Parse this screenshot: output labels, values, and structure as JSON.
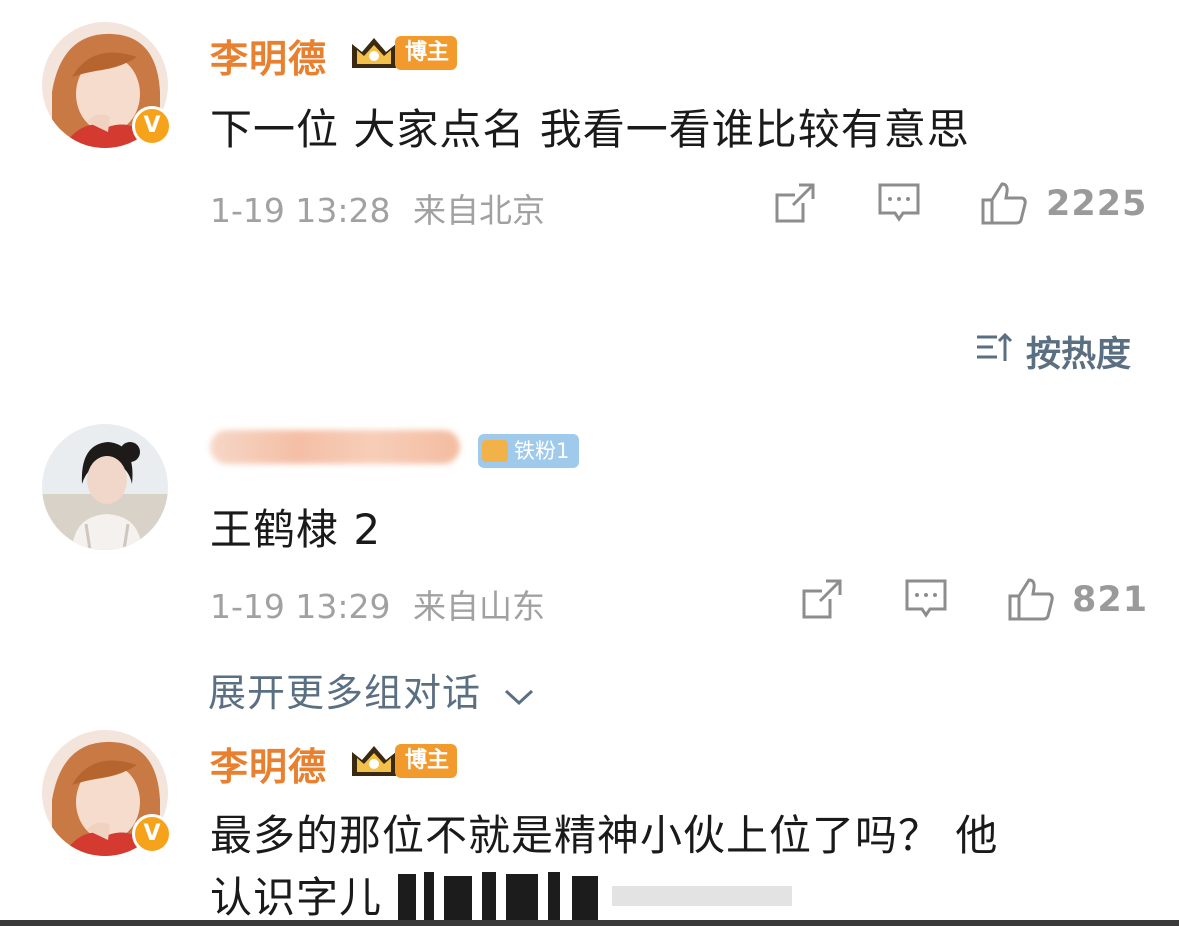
{
  "comments": [
    {
      "username": "李明德",
      "badge": "博主",
      "text": "下一位 大家点名 我看一看谁比较有意思",
      "time": "1-19 13:28",
      "location": "来自北京",
      "likes": "2225",
      "verified_mark": "V"
    },
    {
      "username": "",
      "badge": "铁粉1",
      "text": "王鹤棣 2",
      "time": "1-19 13:29",
      "location": "来自山东",
      "likes": "821"
    },
    {
      "username": "李明德",
      "badge": "博主",
      "text_line1": "最多的那位不就是精神小伙上位了吗？ 他",
      "text_line2": "认识字儿",
      "verified_mark": "V"
    }
  ],
  "sort": {
    "label": "按热度",
    "icon": "sort-icon"
  },
  "expand": {
    "label": "展开更多组对话"
  },
  "colors": {
    "name": "#e8802f",
    "link": "#5b6f82",
    "meta": "#a1a1a1",
    "badge_blogger": "#f39a2c",
    "badge_fan": "#9fcaec"
  },
  "icons": [
    "share-icon",
    "comment-icon",
    "like-icon",
    "crown-icon",
    "chevron-down-icon"
  ]
}
